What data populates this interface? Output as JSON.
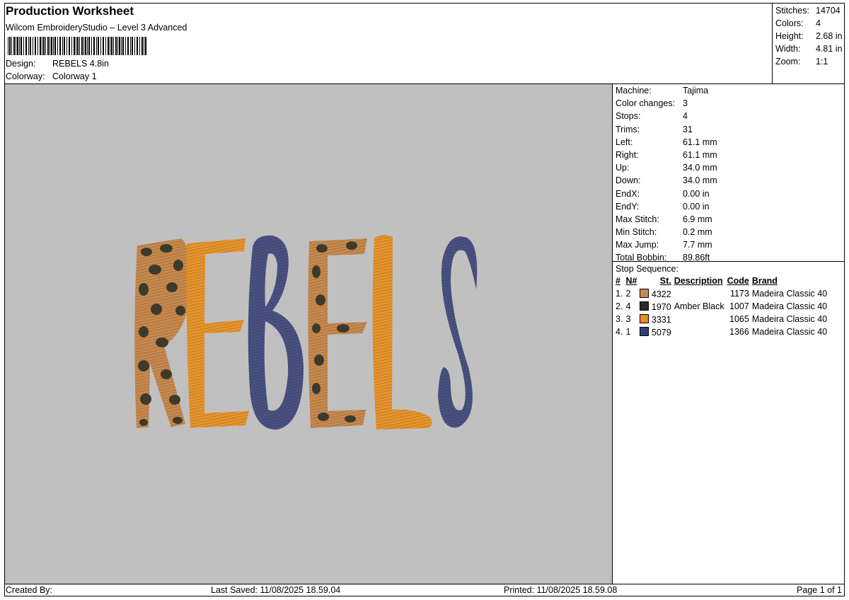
{
  "header": {
    "title": "Production Worksheet",
    "software": "Wilcom EmbroideryStudio – Level 3 Advanced",
    "design_label": "Design:",
    "design_value": "REBELS 4.8in",
    "colorway_label": "Colorway:",
    "colorway_value": "Colorway 1"
  },
  "summary": [
    {
      "label": "Stitches:",
      "value": "14704"
    },
    {
      "label": "Colors:",
      "value": "4"
    },
    {
      "label": "Height:",
      "value": "2.68 in"
    },
    {
      "label": "Width:",
      "value": "4.81 in"
    },
    {
      "label": "Zoom:",
      "value": "1:1"
    }
  ],
  "specs": [
    {
      "label": "Machine:",
      "value": "Tajima"
    },
    {
      "label": "Color changes:",
      "value": "3"
    },
    {
      "label": "Stops:",
      "value": "4"
    },
    {
      "label": "Trims:",
      "value": "31"
    },
    {
      "label": "Left:",
      "value": "61.1 mm"
    },
    {
      "label": "Right:",
      "value": "61.1 mm"
    },
    {
      "label": "Up:",
      "value": "34.0 mm"
    },
    {
      "label": "Down:",
      "value": "34.0 mm"
    },
    {
      "label": "EndX:",
      "value": "0.00 in"
    },
    {
      "label": "EndY:",
      "value": "0.00 in"
    },
    {
      "label": "Max Stitch:",
      "value": "6.9 mm"
    },
    {
      "label": "Min Stitch:",
      "value": "0.2 mm"
    },
    {
      "label": "Max Jump:",
      "value": "7.7 mm"
    },
    {
      "label": "Total Bobbin:",
      "value": "89.86ft"
    }
  ],
  "stop_sequence": {
    "title": "Stop Sequence:",
    "headers": [
      "#",
      "N#",
      "St.",
      "Description",
      "Code",
      "Brand"
    ],
    "rows": [
      {
        "num": "1.",
        "n": "2",
        "color": "#c98a4e",
        "st": "4322",
        "description": "",
        "code": "1173",
        "brand": "Madeira Classic 40"
      },
      {
        "num": "2.",
        "n": "4",
        "color": "#2b2b2b",
        "st": "1970",
        "description": "Amber Black",
        "code": "1007",
        "brand": "Madeira Classic 40"
      },
      {
        "num": "3.",
        "n": "3",
        "color": "#e98a2a",
        "st": "3331",
        "description": "",
        "code": "1065",
        "brand": "Madeira Classic 40"
      },
      {
        "num": "4.",
        "n": "1",
        "color": "#2f3f7a",
        "st": "5079",
        "description": "",
        "code": "1366",
        "brand": "Madeira Classic 40"
      }
    ]
  },
  "design_preview": {
    "text": "REBELS",
    "background": "#c0c0c0",
    "colors": {
      "leopard": "#c98a4e",
      "spots": "#3d3a2c",
      "orange": "#e8952d",
      "navy": "#4a5282"
    }
  },
  "footer": {
    "created_by": "Created By:",
    "last_saved": "Last Saved: 11/08/2025 18.59.04",
    "printed": "Printed: 11/08/2025 18.59.08",
    "page": "Page 1 of 1"
  }
}
